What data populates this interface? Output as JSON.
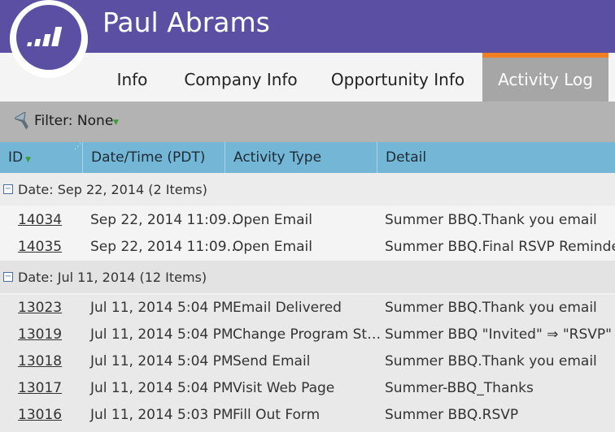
{
  "header": {
    "title": "Paul Abrams"
  },
  "tabs": [
    {
      "label": "Info"
    },
    {
      "label": "Company Info"
    },
    {
      "label": "Opportunity Info"
    },
    {
      "label": "Activity Log"
    }
  ],
  "filter": {
    "label": "Filter: None"
  },
  "columns": [
    "ID",
    "Date/Time (PDT)",
    "Activity Type",
    "Detail"
  ],
  "groups": [
    {
      "label": "Date: Sep 22, 2014 (2 Items)",
      "rows": [
        {
          "id": "14034",
          "datetime": "Sep 22, 2014 11:09…",
          "type": "Open Email",
          "detail": "Summer BBQ.Thank you email"
        },
        {
          "id": "14035",
          "datetime": "Sep 22, 2014 11:09…",
          "type": "Open Email",
          "detail": "Summer BBQ.Final RSVP Reminder"
        }
      ]
    },
    {
      "label": "Date: Jul 11, 2014 (12 Items)",
      "rows": [
        {
          "id": "13023",
          "datetime": "Jul 11, 2014 5:04 PM",
          "type": "Email Delivered",
          "detail": "Summer BBQ.Thank you email"
        },
        {
          "id": "13019",
          "datetime": "Jul 11, 2014 5:04 PM",
          "type": "Change Program St…",
          "detail": "Summer BBQ \"Invited\" ⇒ \"RSVP\""
        },
        {
          "id": "13018",
          "datetime": "Jul 11, 2014 5:04 PM",
          "type": "Send Email",
          "detail": "Summer BBQ.Thank you email"
        },
        {
          "id": "13017",
          "datetime": "Jul 11, 2014 5:04 PM",
          "type": "Visit Web Page",
          "detail": "Summer-BBQ_Thanks"
        },
        {
          "id": "13016",
          "datetime": "Jul 11, 2014 5:03 PM",
          "type": "Fill Out Form",
          "detail": "Summer BBQ.RSVP"
        }
      ]
    }
  ],
  "colors": {
    "header": "#5b4fa3",
    "active_tab_accent": "#ef7f22",
    "column_header": "#74b6d6"
  },
  "icons": {
    "logo": "marketo-bars-logo",
    "filter": "funnel-icon",
    "sort": "sort-down-icon",
    "collapse": "minus-box-icon"
  }
}
